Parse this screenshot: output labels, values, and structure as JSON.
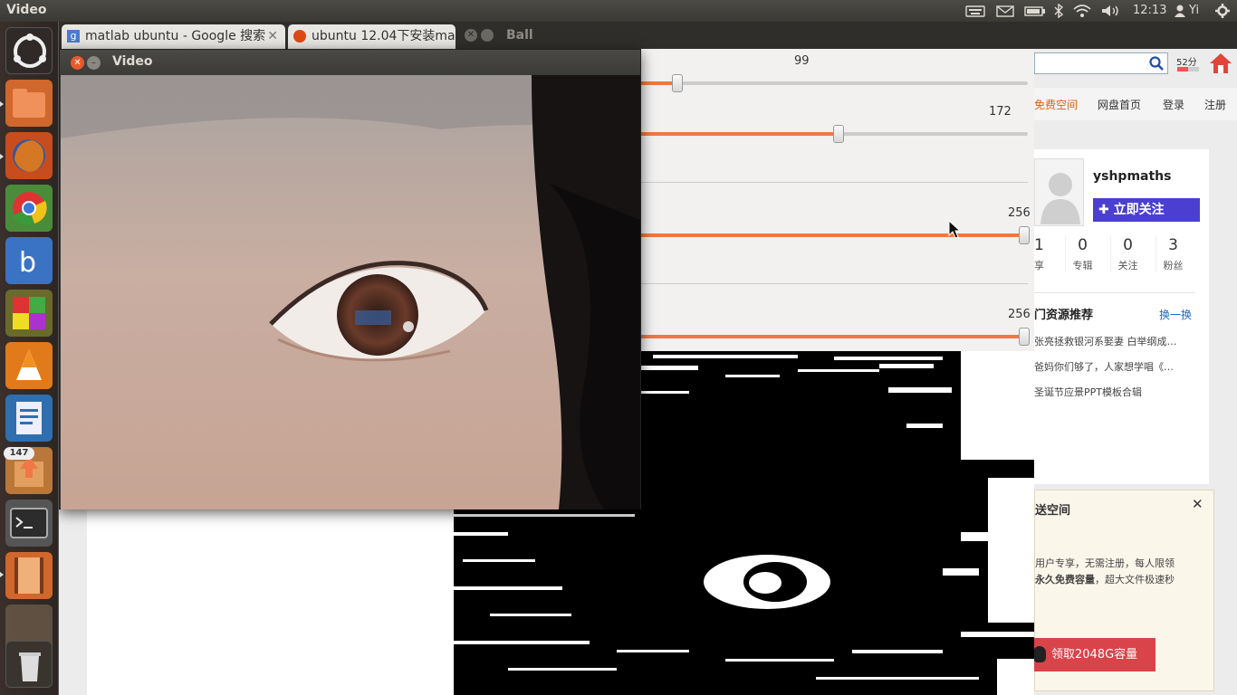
{
  "top_panel": {
    "title": "Video",
    "clock": "12:13",
    "user": "Yi"
  },
  "launcher": {
    "badge_count": "147"
  },
  "browser": {
    "tabs": [
      {
        "label": "matlab ubuntu - Google 搜索"
      },
      {
        "label": "ubuntu 12.04下安装matl"
      }
    ],
    "background_window_title": "Ball"
  },
  "trackbars": [
    {
      "value": "99",
      "fraction": 0.387
    },
    {
      "value": "172",
      "fraction": 0.672
    },
    {
      "value": "256",
      "fraction": 1.0
    },
    {
      "value": "256",
      "fraction": 1.0
    }
  ],
  "pan": {
    "score": "52分",
    "nav": [
      "免费空间",
      "网盘首页",
      "登录",
      "注册"
    ],
    "username": "yshpmaths",
    "follow_label": "立即关注",
    "stats": [
      {
        "value": "1",
        "label": "享"
      },
      {
        "value": "0",
        "label": "专辑"
      },
      {
        "value": "0",
        "label": "关注"
      },
      {
        "value": "3",
        "label": "粉丝"
      }
    ],
    "section_title": "门资源推荐",
    "refresh_label": "换一换",
    "links": [
      "张亮拯救银河系娶妻 白举纲成…",
      "爸妈你们够了，人家想学唱《…",
      "圣诞节应景PPT模板合辑"
    ],
    "popup": {
      "title": "送空间",
      "line1": "用户专享，无需注册，每人限领",
      "line2_bold": "永久免费容量",
      "line2_rest": "，超大文件极速秒",
      "button": "领取2048G容量"
    }
  },
  "video_window": {
    "title": "Video"
  },
  "colors": {
    "accent": "#f07746",
    "ubuntu_orange": "#dd4814",
    "follow": "#4a3fd0",
    "popup_button": "#d9434a"
  }
}
